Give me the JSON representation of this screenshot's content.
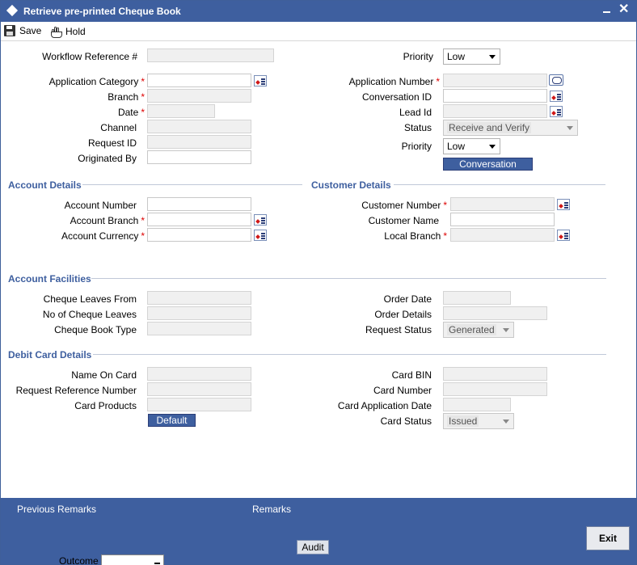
{
  "window": {
    "title": "Retrieve pre-printed Cheque Book"
  },
  "toolbar": {
    "save_label": "Save",
    "hold_label": "Hold"
  },
  "header": {
    "workflow_ref_label": "Workflow Reference #",
    "priority_label": "Priority",
    "priority_value": "Low",
    "app_category_label": "Application Category",
    "branch_label": "Branch",
    "date_label": "Date",
    "channel_label": "Channel",
    "request_id_label": "Request ID",
    "originated_by_label": "Originated By",
    "app_number_label": "Application Number",
    "conversation_id_label": "Conversation ID",
    "lead_id_label": "Lead Id",
    "status_label": "Status",
    "status_value": "Receive and Verify",
    "priority2_label": "Priority",
    "priority2_value": "Low",
    "conversation_button": "Conversation"
  },
  "account_details": {
    "title": "Account Details",
    "account_number_label": "Account Number",
    "account_branch_label": "Account Branch",
    "account_currency_label": "Account Currency"
  },
  "customer_details": {
    "title": "Customer Details",
    "customer_number_label": "Customer Number",
    "customer_name_label": "Customer Name",
    "local_branch_label": "Local Branch"
  },
  "account_facilities": {
    "title": "Account Facilities",
    "cheque_leaves_from_label": "Cheque Leaves From",
    "no_cheque_leaves_label": "No of Cheque Leaves",
    "cheque_book_type_label": "Cheque Book Type",
    "order_date_label": "Order Date",
    "order_details_label": "Order Details",
    "request_status_label": "Request Status",
    "request_status_value": "Generated"
  },
  "debit_card": {
    "title": "Debit Card Details",
    "name_on_card_label": "Name On Card",
    "request_ref_label": "Request Reference Number",
    "card_products_label": "Card Products",
    "default_button": "Default",
    "card_bin_label": "Card BIN",
    "card_number_label": "Card Number",
    "card_app_date_label": "Card Application Date",
    "card_status_label": "Card Status",
    "card_status_value": "Issued"
  },
  "footer": {
    "previous_remarks": "Previous Remarks",
    "remarks": "Remarks",
    "audit": "Audit",
    "exit": "Exit",
    "outcome_label": "Outcome"
  },
  "colors": {
    "brand": "#3e5f9f",
    "required": "#d00000"
  }
}
